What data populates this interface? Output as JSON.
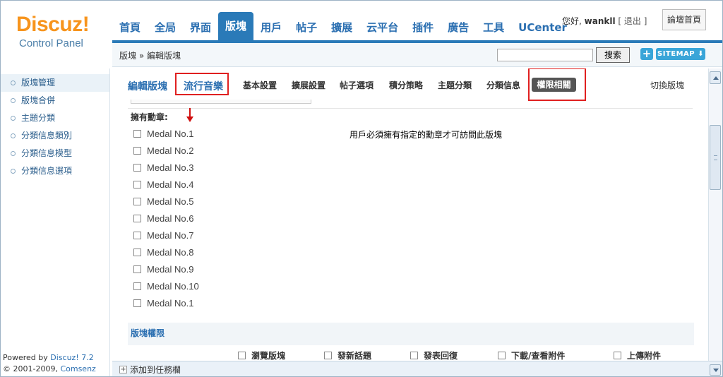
{
  "logo": {
    "brand": "Discuz!",
    "sub": "Control Panel"
  },
  "nav": {
    "tabs": [
      {
        "label": "首頁"
      },
      {
        "label": "全局"
      },
      {
        "label": "界面"
      },
      {
        "label": "版塊",
        "active": true
      },
      {
        "label": "用戶"
      },
      {
        "label": "帖子"
      },
      {
        "label": "擴展"
      },
      {
        "label": "云平台"
      },
      {
        "label": "插件"
      },
      {
        "label": "廣告"
      },
      {
        "label": "工具"
      },
      {
        "label": "UCenter"
      }
    ]
  },
  "user": {
    "greeting": "您好,",
    "name": "wankll",
    "logout": "[ 退出 ]"
  },
  "home_button": "論壇首頁",
  "breadcrumb": "版塊 » 編輯版塊",
  "search": {
    "value": "",
    "button": "搜索"
  },
  "sitemap": {
    "plus": "+",
    "label": "SITEMAP"
  },
  "sidebar": {
    "items": [
      {
        "label": "版塊管理",
        "active": true
      },
      {
        "label": "版塊合併"
      },
      {
        "label": "主題分類"
      },
      {
        "label": "分類信息類別"
      },
      {
        "label": "分類信息模型"
      },
      {
        "label": "分類信息選項"
      }
    ],
    "powered_prefix": "Powered by",
    "powered_link": "Discuz! 7.2",
    "copyright_prefix": "© 2001-2009,",
    "copyright_link": "Comsenz Inc."
  },
  "subtabs": {
    "edit_title": "編輯版塊",
    "forum_name": "流行音樂",
    "tabs": [
      "基本設置",
      "擴展設置",
      "帖子選項",
      "積分策略",
      "主題分類",
      "分類信息"
    ],
    "active_tab": "權限相關",
    "switch": "切換版塊"
  },
  "medals": {
    "label": "擁有勳章:",
    "description": "用戶必須擁有指定的勳章才可訪問此版塊",
    "items": [
      "Medal No.1",
      "Medal No.2",
      "Medal No.3",
      "Medal No.4",
      "Medal No.5",
      "Medal No.6",
      "Medal No.7",
      "Medal No.8",
      "Medal No.9",
      "Medal No.10",
      "Medal No.1"
    ]
  },
  "permissions": {
    "section_title": "版塊權限",
    "columns": [
      "瀏覽版塊",
      "發新話題",
      "發表回復",
      "下載/查看附件",
      "上傳附件"
    ]
  },
  "taskbar": {
    "add_label": "添加到任務欄"
  },
  "colors": {
    "accent": "#2a7ab8",
    "highlight_box": "#e02020",
    "logo_orange": "#f7941d"
  }
}
